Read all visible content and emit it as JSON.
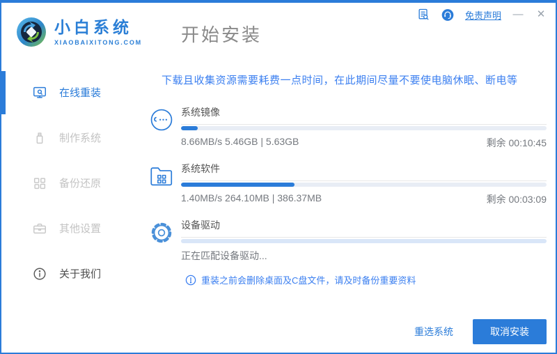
{
  "window": {
    "brand": {
      "name": "小白系统",
      "domain": "XIAOBAIXITONG.COM"
    },
    "page_title": "开始安装",
    "titlebar": {
      "disclaimer": "免责声明",
      "minimize": "—",
      "close": "✕",
      "icons": [
        "license-doc-icon",
        "customer-service-icon"
      ]
    }
  },
  "sidebar": {
    "items": [
      {
        "label": "在线重装",
        "icon": "monitor-reinstall-icon",
        "state": "active"
      },
      {
        "label": "制作系统",
        "icon": "usb-drive-icon",
        "state": "disabled"
      },
      {
        "label": "备份还原",
        "icon": "backup-restore-icon",
        "state": "disabled"
      },
      {
        "label": "其他设置",
        "icon": "toolbox-icon",
        "state": "disabled"
      },
      {
        "label": "关于我们",
        "icon": "info-circle-icon",
        "state": "normal"
      }
    ]
  },
  "main": {
    "warning": "下载且收集资源需要耗费一点时间，在此期间尽量不要使电脑休眠、断电等",
    "tasks": [
      {
        "name": "系统镜像",
        "icon": "mascot-face-icon",
        "percent": 4.5,
        "stats": "8.66MB/s 5.46GB | 5.63GB",
        "remaining": "剩余 00:10:45"
      },
      {
        "name": "系统软件",
        "icon": "folder-apps-icon",
        "percent": 31,
        "stats": "1.40MB/s 264.10MB | 386.37MB",
        "remaining": "剩余 00:03:09"
      },
      {
        "name": "设备驱动",
        "icon": "gear-icon",
        "percent": 0,
        "stats": "正在匹配设备驱动...",
        "remaining": ""
      }
    ],
    "note": "重装之前会删除桌面及C盘文件，请及时备份重要资料",
    "footer": {
      "reselect": "重选系统",
      "cancel": "取消安装"
    }
  },
  "colors": {
    "accent": "#2b7cd9",
    "warning_text": "#3b7ff0",
    "disabled_text": "#c3c3c3",
    "progress_track": "#e8edf5",
    "progress_track_blue": "#d9e6f8",
    "stats_text": "#75797f"
  }
}
